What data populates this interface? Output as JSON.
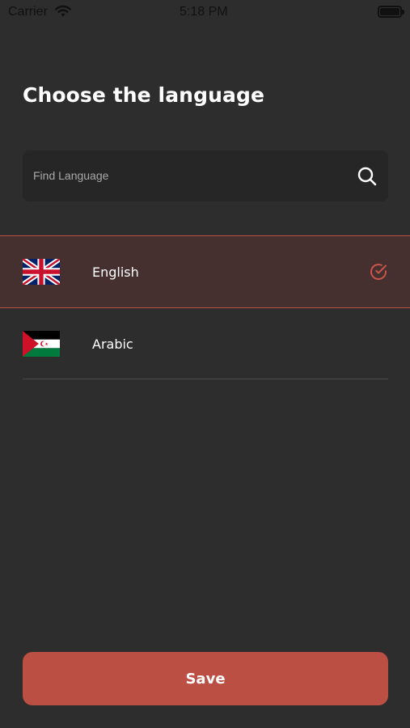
{
  "status_bar": {
    "carrier": "Carrier",
    "time": "5:18 PM",
    "wifi_icon": "wifi-icon",
    "battery_icon": "battery-icon"
  },
  "page": {
    "title": "Choose the language"
  },
  "search": {
    "placeholder": "Find Language",
    "icon": "search-icon"
  },
  "languages": [
    {
      "label": "English",
      "flag": "uk-flag-icon",
      "selected": true
    },
    {
      "label": "Arabic",
      "flag": "arabic-flag-icon",
      "selected": false
    }
  ],
  "actions": {
    "save_label": "Save"
  },
  "colors": {
    "background": "#2d2d2d",
    "accent": "#bc4f43",
    "selected_row": "#452f2f",
    "search_bg": "#262626"
  }
}
